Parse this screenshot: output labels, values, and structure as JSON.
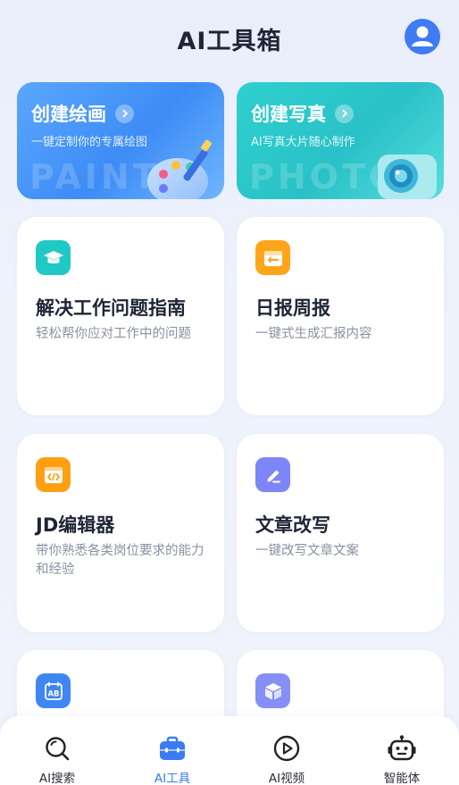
{
  "header": {
    "title": "AI工具箱"
  },
  "banners": [
    {
      "title": "创建绘画",
      "subtitle": "一键定制你的专属绘图",
      "watermark": "PAINT",
      "color": "#4a98f8"
    },
    {
      "title": "创建写真",
      "subtitle": "AI写真大片随心制作",
      "watermark": "PHOTO",
      "color": "#2fc6ca"
    }
  ],
  "tools": [
    {
      "title": "解决工作问题指南",
      "desc": "轻松帮你应对工作中的问题",
      "icon": "graduation-cap-icon",
      "color": "#20c9c6"
    },
    {
      "title": "日报周报",
      "desc": "一键式生成汇报内容",
      "icon": "calendar-report-icon",
      "color": "#ffa51a"
    },
    {
      "title": "JD编辑器",
      "desc": "带你熟悉各类岗位要求的能力和经验",
      "icon": "code-window-icon",
      "color": "#ff9f12"
    },
    {
      "title": "文章改写",
      "desc": "一键改写文章文案",
      "icon": "pen-edit-icon",
      "color": "#7c86f6"
    },
    {
      "title": "",
      "desc": "",
      "icon": "ab-translate-icon",
      "color": "#3f86f3"
    },
    {
      "title": "",
      "desc": "",
      "icon": "box-icon",
      "color": "#858ff5"
    }
  ],
  "tabbar": [
    {
      "label": "AI搜索",
      "icon": "search-icon",
      "active": false
    },
    {
      "label": "AI工具",
      "icon": "toolbox-icon",
      "active": true
    },
    {
      "label": "AI视频",
      "icon": "play-circle-icon",
      "active": false
    },
    {
      "label": "智能体",
      "icon": "robot-icon",
      "active": false
    }
  ],
  "colors": {
    "accent": "#3a7bf2",
    "background": "#eaeffb"
  }
}
